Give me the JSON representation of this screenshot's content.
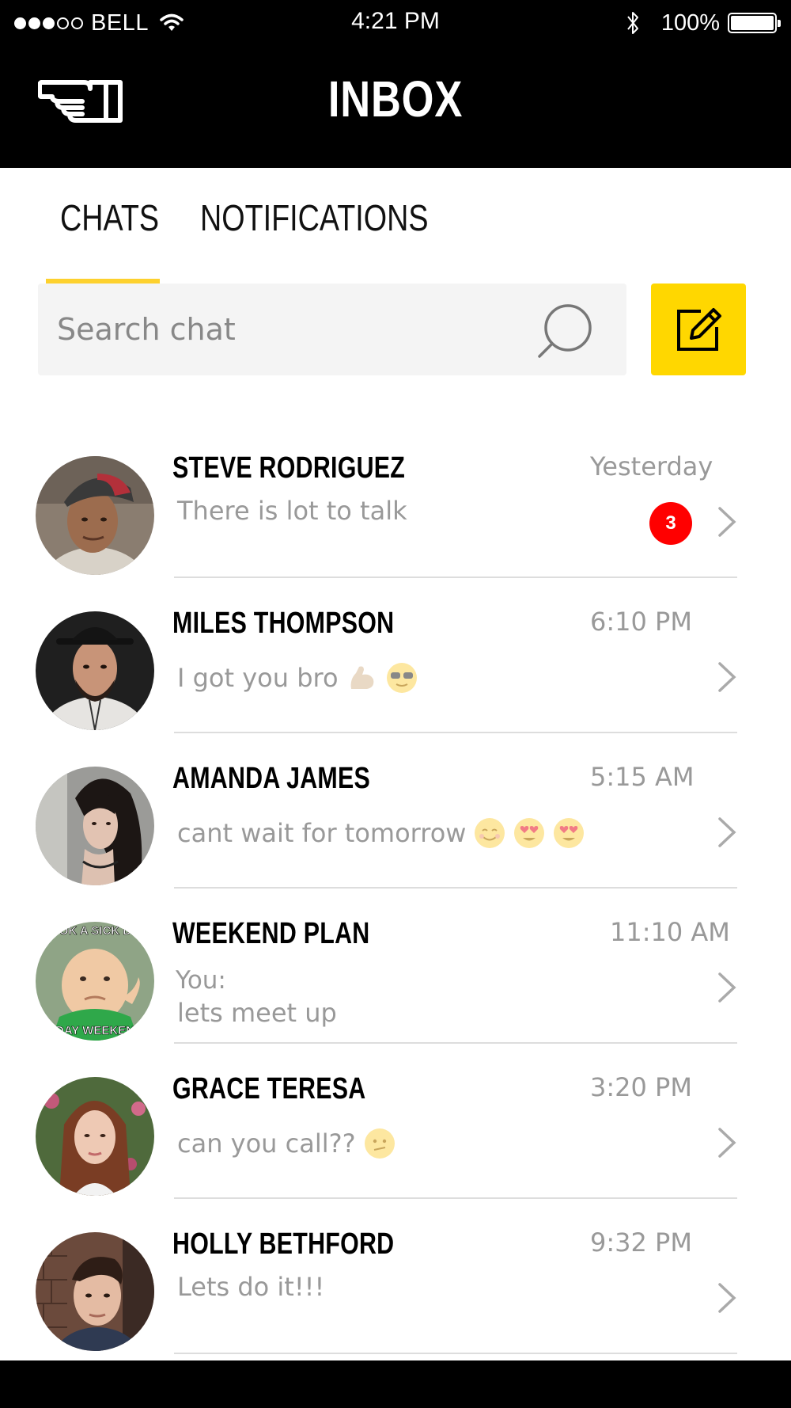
{
  "status_bar": {
    "carrier": "BELL",
    "time": "4:21 PM",
    "battery": "100%",
    "signal_bars_filled": 3,
    "signal_bars_total": 5
  },
  "header": {
    "title": "INBOX",
    "menu_icon": "pointing-hand-icon"
  },
  "tabs": [
    {
      "label": "CHATS",
      "active": true
    },
    {
      "label": "NOTIFICATIONS",
      "active": false
    }
  ],
  "search": {
    "placeholder": "Search chat",
    "icon": "search-icon"
  },
  "compose": {
    "icon": "compose-icon",
    "color": "#FFD700"
  },
  "accent_color": "#FDD12E",
  "badge_color": "#FF0000",
  "chats": [
    {
      "name": "STEVE RODRIGUEZ",
      "time": "Yesterday",
      "message": "There is lot to talk",
      "unread": "3",
      "emojis": []
    },
    {
      "name": "MILES THOMPSON",
      "time": "6:10 PM",
      "message": "I got you bro",
      "emojis": [
        "flexed-biceps-emoji",
        "sunglasses-emoji"
      ]
    },
    {
      "name": "AMANDA JAMES",
      "time": "5:15 AM",
      "message": "cant wait for tomorrow",
      "emojis": [
        "smiling-emoji",
        "heart-eyes-emoji",
        "heart-eyes-emoji"
      ]
    },
    {
      "name": "WEEKEND PLAN",
      "time": "11:10 AM",
      "sender": "You:",
      "message": "lets meet up",
      "emojis": [],
      "avatar_caption_top": "OOK A SICK DA",
      "avatar_caption_bottom": "DAY WEEKEN"
    },
    {
      "name": "GRACE TERESA",
      "time": "3:20 PM",
      "message": "can you call??",
      "emojis": [
        "confused-emoji"
      ]
    },
    {
      "name": "HOLLY BETHFORD",
      "time": "9:32 PM",
      "message": "Lets do it!!!",
      "emojis": []
    }
  ]
}
